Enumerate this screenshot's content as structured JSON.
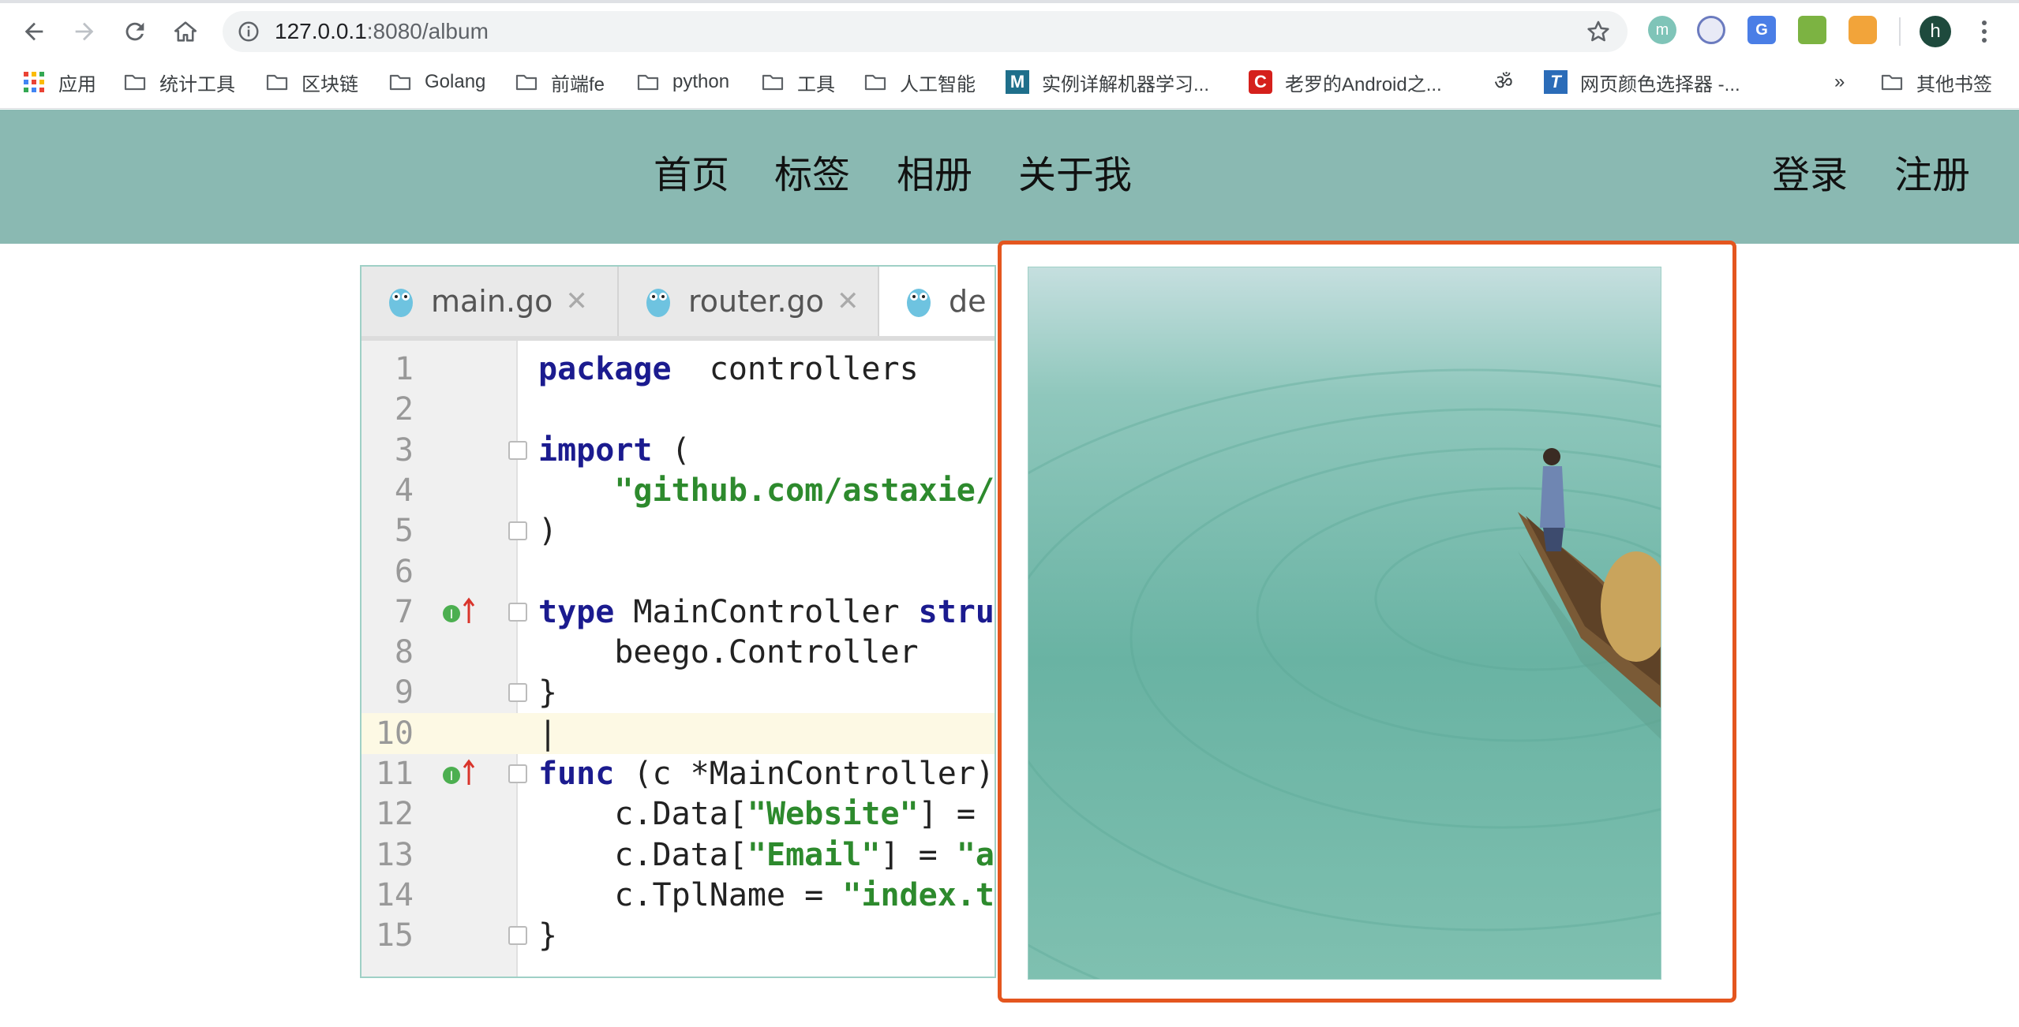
{
  "browser": {
    "url_host": "127.0.0.1",
    "url_path": ":8080/album",
    "profile_initial": "h"
  },
  "bookmarks": [
    {
      "label": "应用",
      "icon": "apps-grid-icon"
    },
    {
      "label": "统计工具",
      "icon": "folder-icon"
    },
    {
      "label": "区块链",
      "icon": "folder-icon"
    },
    {
      "label": "Golang",
      "icon": "folder-icon"
    },
    {
      "label": "前端fe",
      "icon": "folder-icon"
    },
    {
      "label": "python",
      "icon": "folder-icon"
    },
    {
      "label": "工具",
      "icon": "folder-icon"
    },
    {
      "label": "人工智能",
      "icon": "folder-icon"
    },
    {
      "label": "实例详解机器学习...",
      "icon": "site-m-icon"
    },
    {
      "label": "老罗的Android之...",
      "icon": "site-c-icon"
    },
    {
      "label": "",
      "icon": "site-script-icon"
    },
    {
      "label": "网页颜色选择器 -...",
      "icon": "site-t-icon"
    },
    {
      "label": "»",
      "icon": ""
    },
    {
      "label": "其他书签",
      "icon": "folder-icon"
    }
  ],
  "site": {
    "nav": [
      "首页",
      "标签",
      "相册",
      "关于我"
    ],
    "auth": [
      "登录",
      "注册"
    ]
  },
  "album": {
    "photo1": {
      "tabs": [
        "main.go",
        "router.go",
        "de"
      ],
      "lines": [
        {
          "n": "1",
          "parts": [
            [
              "kw",
              "package"
            ],
            [
              "",
              "  controllers"
            ]
          ]
        },
        {
          "n": "2",
          "parts": []
        },
        {
          "n": "3",
          "parts": [
            [
              "kw",
              "import"
            ],
            [
              "",
              " ("
            ]
          ]
        },
        {
          "n": "4",
          "parts": [
            [
              "",
              "    "
            ],
            [
              "str",
              "\"github.com/astaxie/"
            ]
          ]
        },
        {
          "n": "5",
          "parts": [
            [
              "",
              ")"
            ]
          ]
        },
        {
          "n": "6",
          "parts": []
        },
        {
          "n": "7",
          "parts": [
            [
              "kw",
              "type"
            ],
            [
              "",
              " MainController "
            ],
            [
              "kw",
              "stru"
            ]
          ]
        },
        {
          "n": "8",
          "parts": [
            [
              "",
              "    beego.Controller"
            ]
          ]
        },
        {
          "n": "9",
          "parts": [
            [
              "",
              "}"
            ]
          ]
        },
        {
          "n": "10",
          "parts": [
            [
              "",
              "|"
            ]
          ]
        },
        {
          "n": "11",
          "parts": [
            [
              "kw",
              "func"
            ],
            [
              "",
              " (c *MainController)"
            ]
          ]
        },
        {
          "n": "12",
          "parts": [
            [
              "",
              "    c.Data["
            ],
            [
              "str",
              "\"Website\""
            ],
            [
              "",
              "] ="
            ]
          ]
        },
        {
          "n": "13",
          "parts": [
            [
              "",
              "    c.Data["
            ],
            [
              "str",
              "\"Email\""
            ],
            [
              "",
              "] = "
            ],
            [
              "str",
              "\"a"
            ]
          ]
        },
        {
          "n": "14",
          "parts": [
            [
              "",
              "    c.TplName = "
            ],
            [
              "str",
              "\"index.t"
            ]
          ]
        },
        {
          "n": "15",
          "parts": [
            [
              "",
              "}"
            ]
          ]
        }
      ]
    },
    "photo2": {
      "subject": "person standing in a wooden boat on green water"
    },
    "selected_border_color": "#e4561f",
    "header_color": "#8ab9b2"
  }
}
